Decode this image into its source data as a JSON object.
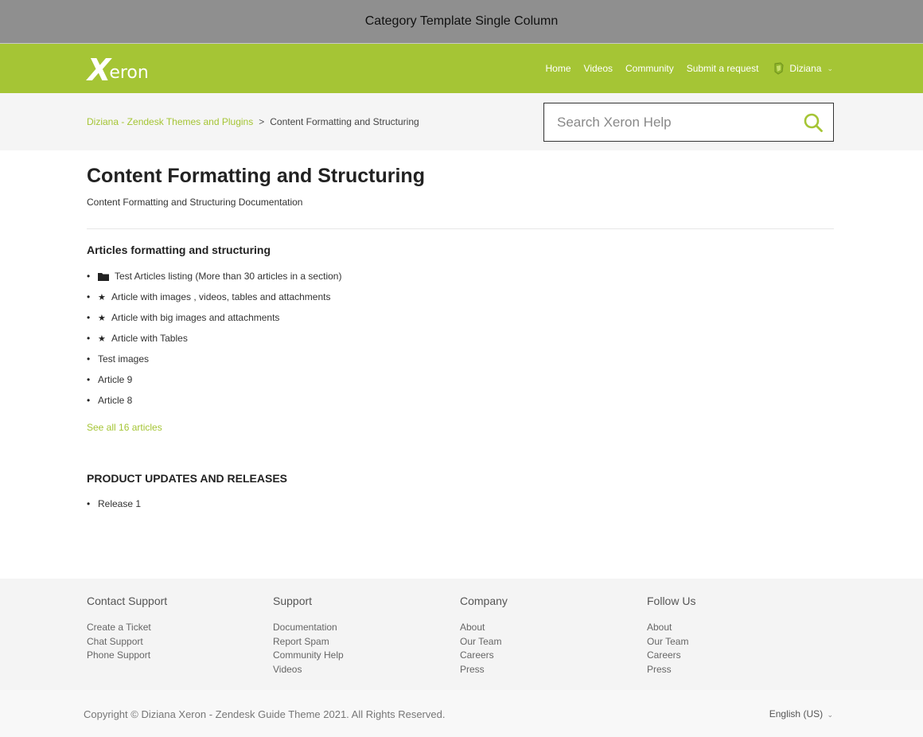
{
  "window": {
    "title": "Category Template Single Column"
  },
  "header": {
    "logo": {
      "mark": "X",
      "rest": "eron"
    },
    "nav": [
      "Home",
      "Videos",
      "Community",
      "Submit a request"
    ],
    "user": {
      "name": "Diziana"
    }
  },
  "breadcrumb": {
    "items": [
      "Diziana - Zendesk Themes and Plugins",
      "Content Formatting and Structuring"
    ],
    "separator": ">"
  },
  "search": {
    "placeholder": "Search Xeron Help",
    "value": ""
  },
  "category": {
    "title": "Content Formatting and Structuring",
    "description": "Content Formatting and Structuring Documentation"
  },
  "sections": [
    {
      "title": "Articles formatting and structuring",
      "articles": [
        {
          "label": "Test Articles listing (More than 30 articles in a section)",
          "icon": "folder-icon"
        },
        {
          "label": "Article with images , videos, tables and attachments",
          "icon": "star-icon"
        },
        {
          "label": "Article with big images and attachments",
          "icon": "star-icon"
        },
        {
          "label": "Article with Tables",
          "icon": "star-icon"
        },
        {
          "label": "Test images",
          "icon": ""
        },
        {
          "label": "Article 9",
          "icon": ""
        },
        {
          "label": "Article 8",
          "icon": ""
        }
      ],
      "see_all": "See all 16 articles"
    },
    {
      "title": "PRODUCT UPDATES AND RELEASES",
      "articles": [
        {
          "label": "Release 1",
          "icon": ""
        }
      ]
    }
  ],
  "footer": {
    "columns": [
      {
        "title": "Contact Support",
        "links": [
          "Create a Ticket",
          "Chat Support",
          "Phone Support"
        ]
      },
      {
        "title": "Support",
        "links": [
          "Documentation",
          "Report Spam",
          "Community Help",
          "Videos"
        ]
      },
      {
        "title": "Company",
        "links": [
          "About",
          "Our Team",
          "Careers",
          "Press"
        ]
      },
      {
        "title": "Follow Us",
        "links": [
          "About",
          "Our Team",
          "Careers",
          "Press"
        ]
      }
    ],
    "copyright": "Copyright © Diziana Xeron - Zendesk Guide Theme 2021. All Rights Reserved.",
    "language": "English (US)"
  },
  "colors": {
    "brand": "#a5c535",
    "topbar": "#8f8f8f",
    "footer_bg": "#f4f4f4"
  }
}
